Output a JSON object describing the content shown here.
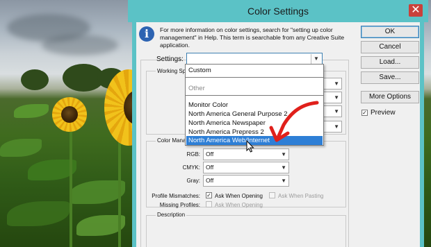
{
  "dialog": {
    "title": "Color Settings",
    "close_glyph": "✕",
    "info_text": "For more information on color settings, search for \"setting up color management\" in Help. This term is searchable from any Creative Suite application."
  },
  "settings": {
    "label": "Settings:",
    "value": "",
    "options": [
      "Custom",
      "Other",
      "Monitor Color",
      "North America General Purpose 2",
      "North America Newspaper",
      "North America Prepress 2",
      "North America Web/Internet"
    ],
    "highlighted": "North America Web/Internet"
  },
  "working_spaces": {
    "label": "Working Sp"
  },
  "color_management": {
    "label": "Color Mana",
    "rgb_label": "RGB:",
    "rgb_value": "Off",
    "cmyk_label": "CMYK:",
    "cmyk_value": "Off",
    "gray_label": "Gray:",
    "gray_value": "Off",
    "profile_mismatches_label": "Profile Mismatches:",
    "missing_profiles_label": "Missing Profiles:",
    "ask_when_opening_label": "Ask When Opening",
    "ask_when_pasting_label": "Ask When Pasting",
    "ask_when_opening_missing_label": "Ask When Opening",
    "ask_when_opening_checked": true,
    "ask_when_pasting_checked": false,
    "missing_ask_checked": false
  },
  "description": {
    "label": "Description"
  },
  "buttons": {
    "ok": "OK",
    "cancel": "Cancel",
    "load": "Load...",
    "save": "Save...",
    "more_options": "More Options",
    "preview_label": "Preview",
    "preview_checked": true
  },
  "colors": {
    "titlebar": "#5bc2c6",
    "highlight": "#2e7fd6",
    "annotation": "#e0201b"
  }
}
